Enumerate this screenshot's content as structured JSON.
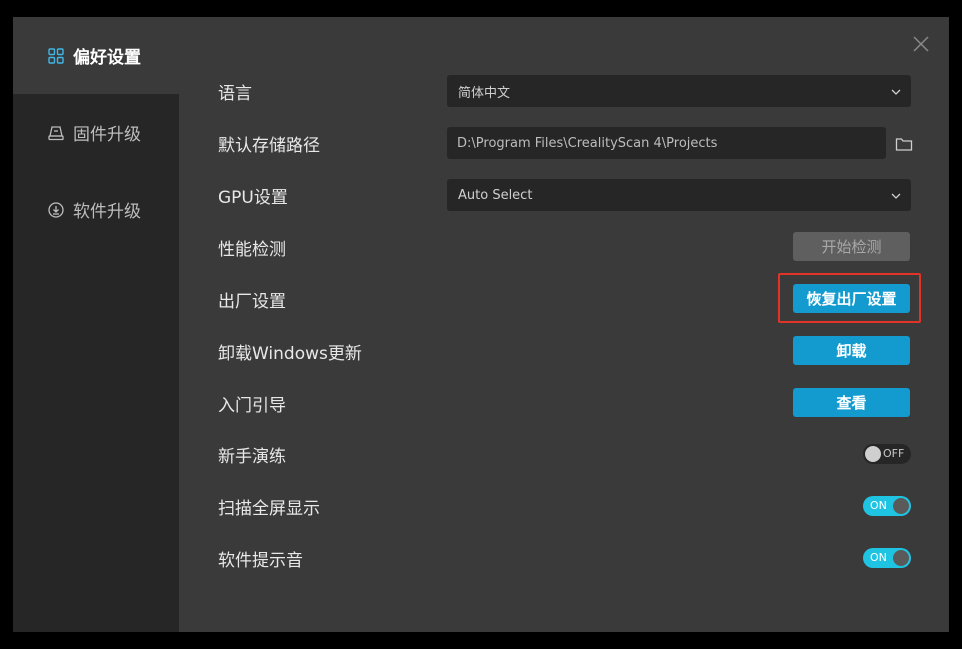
{
  "sidebar": {
    "items": [
      {
        "label": "偏好设置",
        "icon": "grid-icon",
        "active": true
      },
      {
        "label": "固件升级",
        "icon": "device-icon",
        "active": false
      },
      {
        "label": "软件升级",
        "icon": "update-icon",
        "active": false
      }
    ]
  },
  "settings": {
    "language": {
      "label": "语言",
      "value": "简体中文"
    },
    "storage_path": {
      "label": "默认存储路径",
      "value": "D:\\Program Files\\CrealityScan 4\\Projects"
    },
    "gpu": {
      "label": "GPU设置",
      "value": "Auto Select"
    },
    "performance": {
      "label": "性能检测",
      "button": "开始检测"
    },
    "factory": {
      "label": "出厂设置",
      "button": "恢复出厂设置"
    },
    "uninstall": {
      "label": "卸载Windows更新",
      "button": "卸载"
    },
    "guide": {
      "label": "入门引导",
      "button": "查看"
    },
    "practice": {
      "label": "新手演练",
      "toggle": "OFF"
    },
    "fullscreen": {
      "label": "扫描全屏显示",
      "toggle": "ON"
    },
    "sound": {
      "label": "软件提示音",
      "toggle": "ON"
    }
  },
  "colors": {
    "accent": "#139bd0",
    "toggle_on": "#1fc4e3",
    "highlight": "#e23327"
  }
}
